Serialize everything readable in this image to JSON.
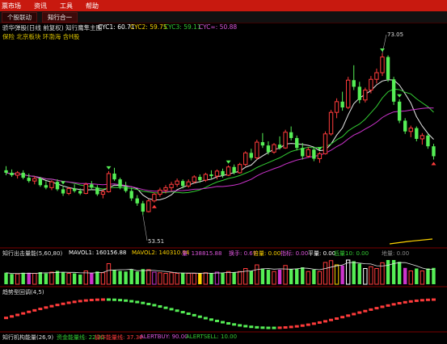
{
  "menu": [
    "票市场",
    "资讯",
    "工具",
    "帮助"
  ],
  "tabs": [
    "个股联动",
    "知行合一"
  ],
  "main_panel": {
    "title": "骄华弹股(日线 前复权) 知行鹰隼主图",
    "cyc1": "CYC1: 60.71",
    "cyc2": "CYC2: 59.75",
    "cyc3": "CYC3: 59.11",
    "cycinf": "CYC∞: 50.88",
    "subtitle": "保险 北京板块 环渤海 含H股",
    "high_label": "73.05",
    "low_label": "53.51"
  },
  "volume_panel": {
    "title": "知行出击量能(5,60,80)",
    "mavol1": "MAVOL1: 160156.88",
    "mavol2": "MAVOL2: 140310.94",
    "f1": "量: 138815.88",
    "f2": "换手: 0.67",
    "f3": "倍量: 0.00",
    "f4": "指标: 0.00",
    "f5": "平量: 0.00",
    "f6": "低量10: 0.00",
    "f7": "地量: 0.00"
  },
  "indicator_panel": {
    "title": "趋势型回调(4,5)"
  },
  "bottom_panel": {
    "title": "知行机构能量(26,9)",
    "f1": "资金能量线: 22.32",
    "f2": "操作能量线: 37.30",
    "f3": "ALERTBUY: 90.00",
    "f4": "ALERTSELL: 10.00"
  },
  "colors": {
    "up": "#ff3b3b",
    "down": "#55ee55",
    "white_line": "#e8e8e8",
    "green_line": "#33cc33",
    "magenta_line": "#cc33cc",
    "yellow": "#ffd400",
    "menu_bg": "#c8190f"
  },
  "chart_data": {
    "type": "candlestick",
    "ylim": [
      50,
      75
    ],
    "candles": [
      {
        "o": 58.9,
        "h": 59.4,
        "l": 58.3,
        "c": 58.6
      },
      {
        "o": 58.6,
        "h": 59.0,
        "l": 58.1,
        "c": 58.3
      },
      {
        "o": 58.3,
        "h": 58.8,
        "l": 57.9,
        "c": 58.6
      },
      {
        "o": 58.6,
        "h": 58.9,
        "l": 57.8,
        "c": 58.0
      },
      {
        "o": 58.0,
        "h": 58.5,
        "l": 57.4,
        "c": 57.6
      },
      {
        "o": 57.6,
        "h": 58.2,
        "l": 57.2,
        "c": 57.9
      },
      {
        "o": 57.9,
        "h": 58.1,
        "l": 56.9,
        "c": 57.1
      },
      {
        "o": 57.1,
        "h": 57.6,
        "l": 56.6,
        "c": 56.8
      },
      {
        "o": 56.8,
        "h": 57.7,
        "l": 56.5,
        "c": 57.5
      },
      {
        "o": 57.5,
        "h": 57.8,
        "l": 56.4,
        "c": 56.6
      },
      {
        "o": 56.6,
        "h": 57.0,
        "l": 55.8,
        "c": 56.1
      },
      {
        "o": 56.1,
        "h": 56.9,
        "l": 55.9,
        "c": 56.7
      },
      {
        "o": 56.7,
        "h": 57.2,
        "l": 56.2,
        "c": 56.4
      },
      {
        "o": 56.4,
        "h": 56.7,
        "l": 55.9,
        "c": 56.1
      },
      {
        "o": 56.1,
        "h": 57.4,
        "l": 56.0,
        "c": 57.2
      },
      {
        "o": 57.2,
        "h": 57.6,
        "l": 56.5,
        "c": 56.8
      },
      {
        "o": 56.8,
        "h": 57.1,
        "l": 55.8,
        "c": 56.0
      },
      {
        "o": 56.0,
        "h": 56.6,
        "l": 55.5,
        "c": 56.3
      },
      {
        "o": 56.3,
        "h": 58.8,
        "l": 56.2,
        "c": 58.5
      },
      {
        "o": 58.5,
        "h": 59.2,
        "l": 57.6,
        "c": 57.8
      },
      {
        "o": 57.8,
        "h": 58.0,
        "l": 56.6,
        "c": 56.9
      },
      {
        "o": 56.9,
        "h": 57.5,
        "l": 56.2,
        "c": 56.4
      },
      {
        "o": 56.4,
        "h": 56.8,
        "l": 55.2,
        "c": 55.5
      },
      {
        "o": 55.5,
        "h": 55.9,
        "l": 54.6,
        "c": 54.9
      },
      {
        "o": 54.9,
        "h": 55.2,
        "l": 53.5,
        "c": 53.9
      },
      {
        "o": 53.9,
        "h": 55.4,
        "l": 53.8,
        "c": 55.2
      },
      {
        "o": 55.2,
        "h": 56.2,
        "l": 55.0,
        "c": 56.0
      },
      {
        "o": 56.0,
        "h": 56.8,
        "l": 55.7,
        "c": 56.5
      },
      {
        "o": 56.5,
        "h": 57.1,
        "l": 56.1,
        "c": 56.8
      },
      {
        "o": 56.8,
        "h": 57.5,
        "l": 56.4,
        "c": 57.2
      },
      {
        "o": 57.2,
        "h": 57.9,
        "l": 56.9,
        "c": 57.6
      },
      {
        "o": 57.6,
        "h": 57.8,
        "l": 56.7,
        "c": 57.0
      },
      {
        "o": 57.0,
        "h": 57.8,
        "l": 56.8,
        "c": 57.5
      },
      {
        "o": 57.5,
        "h": 58.3,
        "l": 57.3,
        "c": 58.1
      },
      {
        "o": 58.1,
        "h": 58.4,
        "l": 57.4,
        "c": 57.7
      },
      {
        "o": 57.7,
        "h": 58.6,
        "l": 57.5,
        "c": 58.4
      },
      {
        "o": 58.4,
        "h": 58.9,
        "l": 57.9,
        "c": 58.2
      },
      {
        "o": 58.2,
        "h": 59.0,
        "l": 57.8,
        "c": 58.8
      },
      {
        "o": 58.8,
        "h": 59.1,
        "l": 58.0,
        "c": 58.3
      },
      {
        "o": 58.3,
        "h": 59.5,
        "l": 58.2,
        "c": 59.3
      },
      {
        "o": 59.3,
        "h": 59.6,
        "l": 58.4,
        "c": 58.6
      },
      {
        "o": 58.6,
        "h": 59.8,
        "l": 58.5,
        "c": 59.6
      },
      {
        "o": 59.6,
        "h": 61.2,
        "l": 59.4,
        "c": 61.0
      },
      {
        "o": 61.0,
        "h": 61.5,
        "l": 60.1,
        "c": 60.4
      },
      {
        "o": 60.4,
        "h": 62.6,
        "l": 60.2,
        "c": 62.3
      },
      {
        "o": 62.3,
        "h": 63.4,
        "l": 61.6,
        "c": 61.9
      },
      {
        "o": 61.9,
        "h": 62.4,
        "l": 60.8,
        "c": 61.1
      },
      {
        "o": 61.1,
        "h": 62.2,
        "l": 60.9,
        "c": 62.0
      },
      {
        "o": 62.0,
        "h": 63.0,
        "l": 61.4,
        "c": 61.6
      },
      {
        "o": 61.6,
        "h": 63.8,
        "l": 61.5,
        "c": 63.5
      },
      {
        "o": 63.5,
        "h": 64.2,
        "l": 62.5,
        "c": 62.8
      },
      {
        "o": 62.8,
        "h": 63.1,
        "l": 61.3,
        "c": 61.6
      },
      {
        "o": 61.6,
        "h": 62.2,
        "l": 60.2,
        "c": 60.6
      },
      {
        "o": 60.6,
        "h": 61.7,
        "l": 60.4,
        "c": 61.4
      },
      {
        "o": 61.4,
        "h": 61.6,
        "l": 60.0,
        "c": 60.3
      },
      {
        "o": 60.3,
        "h": 61.1,
        "l": 59.8,
        "c": 60.9
      },
      {
        "o": 60.9,
        "h": 63.6,
        "l": 60.8,
        "c": 63.3
      },
      {
        "o": 63.3,
        "h": 66.2,
        "l": 63.1,
        "c": 65.9
      },
      {
        "o": 65.9,
        "h": 67.6,
        "l": 65.2,
        "c": 67.2
      },
      {
        "o": 67.2,
        "h": 68.4,
        "l": 66.1,
        "c": 66.5
      },
      {
        "o": 66.5,
        "h": 70.2,
        "l": 66.3,
        "c": 69.8
      },
      {
        "o": 69.8,
        "h": 71.6,
        "l": 68.6,
        "c": 69.0
      },
      {
        "o": 69.0,
        "h": 69.6,
        "l": 67.0,
        "c": 67.4
      },
      {
        "o": 67.4,
        "h": 68.9,
        "l": 67.1,
        "c": 68.6
      },
      {
        "o": 68.6,
        "h": 70.3,
        "l": 68.2,
        "c": 69.9
      },
      {
        "o": 69.9,
        "h": 71.2,
        "l": 69.4,
        "c": 70.7
      },
      {
        "o": 70.7,
        "h": 73.05,
        "l": 70.3,
        "c": 72.6
      },
      {
        "o": 72.6,
        "h": 72.8,
        "l": 69.6,
        "c": 69.9
      },
      {
        "o": 69.9,
        "h": 70.2,
        "l": 66.8,
        "c": 67.2
      },
      {
        "o": 67.2,
        "h": 67.5,
        "l": 64.6,
        "c": 64.9
      },
      {
        "o": 64.9,
        "h": 65.2,
        "l": 63.3,
        "c": 63.6
      },
      {
        "o": 63.6,
        "h": 64.3,
        "l": 62.9,
        "c": 64.0
      },
      {
        "o": 64.0,
        "h": 64.2,
        "l": 62.4,
        "c": 62.7
      },
      {
        "o": 62.7,
        "h": 63.4,
        "l": 62.0,
        "c": 63.1
      },
      {
        "o": 63.1,
        "h": 63.3,
        "l": 61.5,
        "c": 61.8
      },
      {
        "o": 61.8,
        "h": 62.1,
        "l": 60.2,
        "c": 60.6
      }
    ]
  }
}
